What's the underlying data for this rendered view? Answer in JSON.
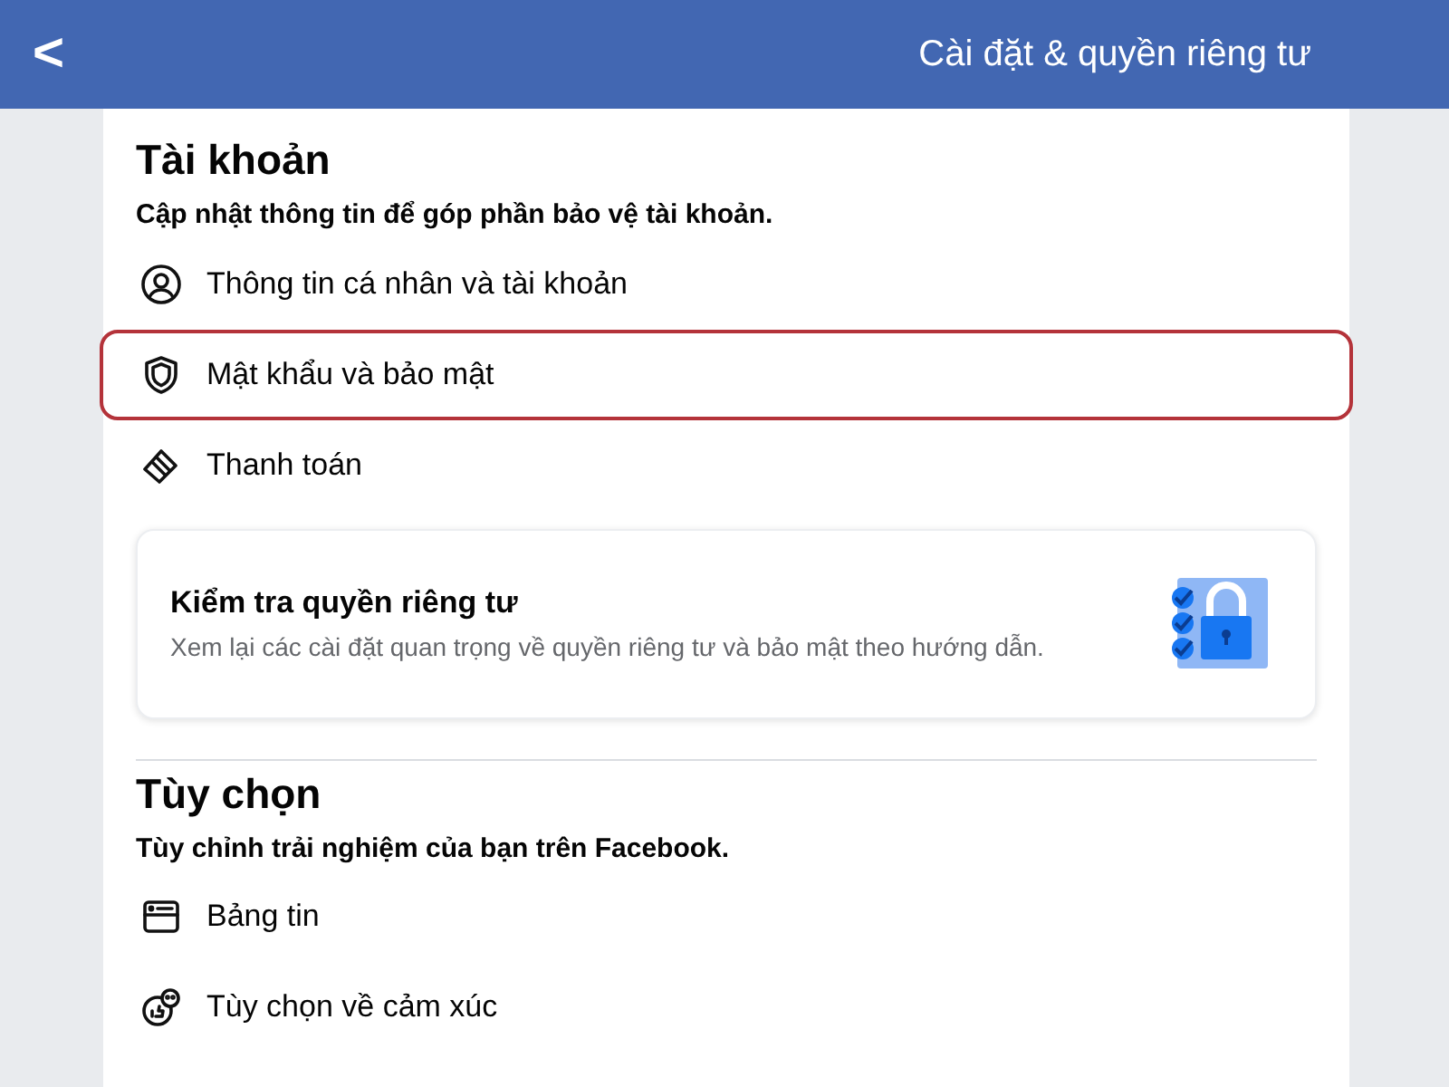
{
  "header": {
    "back_label": "<",
    "title": "Cài đặt & quyền riêng tư"
  },
  "sections": [
    {
      "title": "Tài khoản",
      "subtitle": "Cập nhật thông tin để góp phần bảo vệ tài khoản.",
      "items": [
        {
          "kind": "profile",
          "label": "Thông tin cá nhân và tài khoản",
          "highlighted": false
        },
        {
          "kind": "shield",
          "label": "Mật khẩu và bảo mật",
          "highlighted": true
        },
        {
          "kind": "card",
          "label": "Thanh toán",
          "highlighted": false
        }
      ],
      "card": {
        "title": "Kiểm tra quyền riêng tư",
        "description": "Xem lại các cài đặt quan trọng về quyền riêng tư và bảo mật theo hướng dẫn."
      }
    },
    {
      "title": "Tùy chọn",
      "subtitle": "Tùy chỉnh trải nghiệm của bạn trên Facebook.",
      "items": [
        {
          "kind": "feed",
          "label": "Bảng tin",
          "highlighted": false
        },
        {
          "kind": "reactions",
          "label": "Tùy chọn về cảm xúc",
          "highlighted": false
        }
      ]
    }
  ]
}
